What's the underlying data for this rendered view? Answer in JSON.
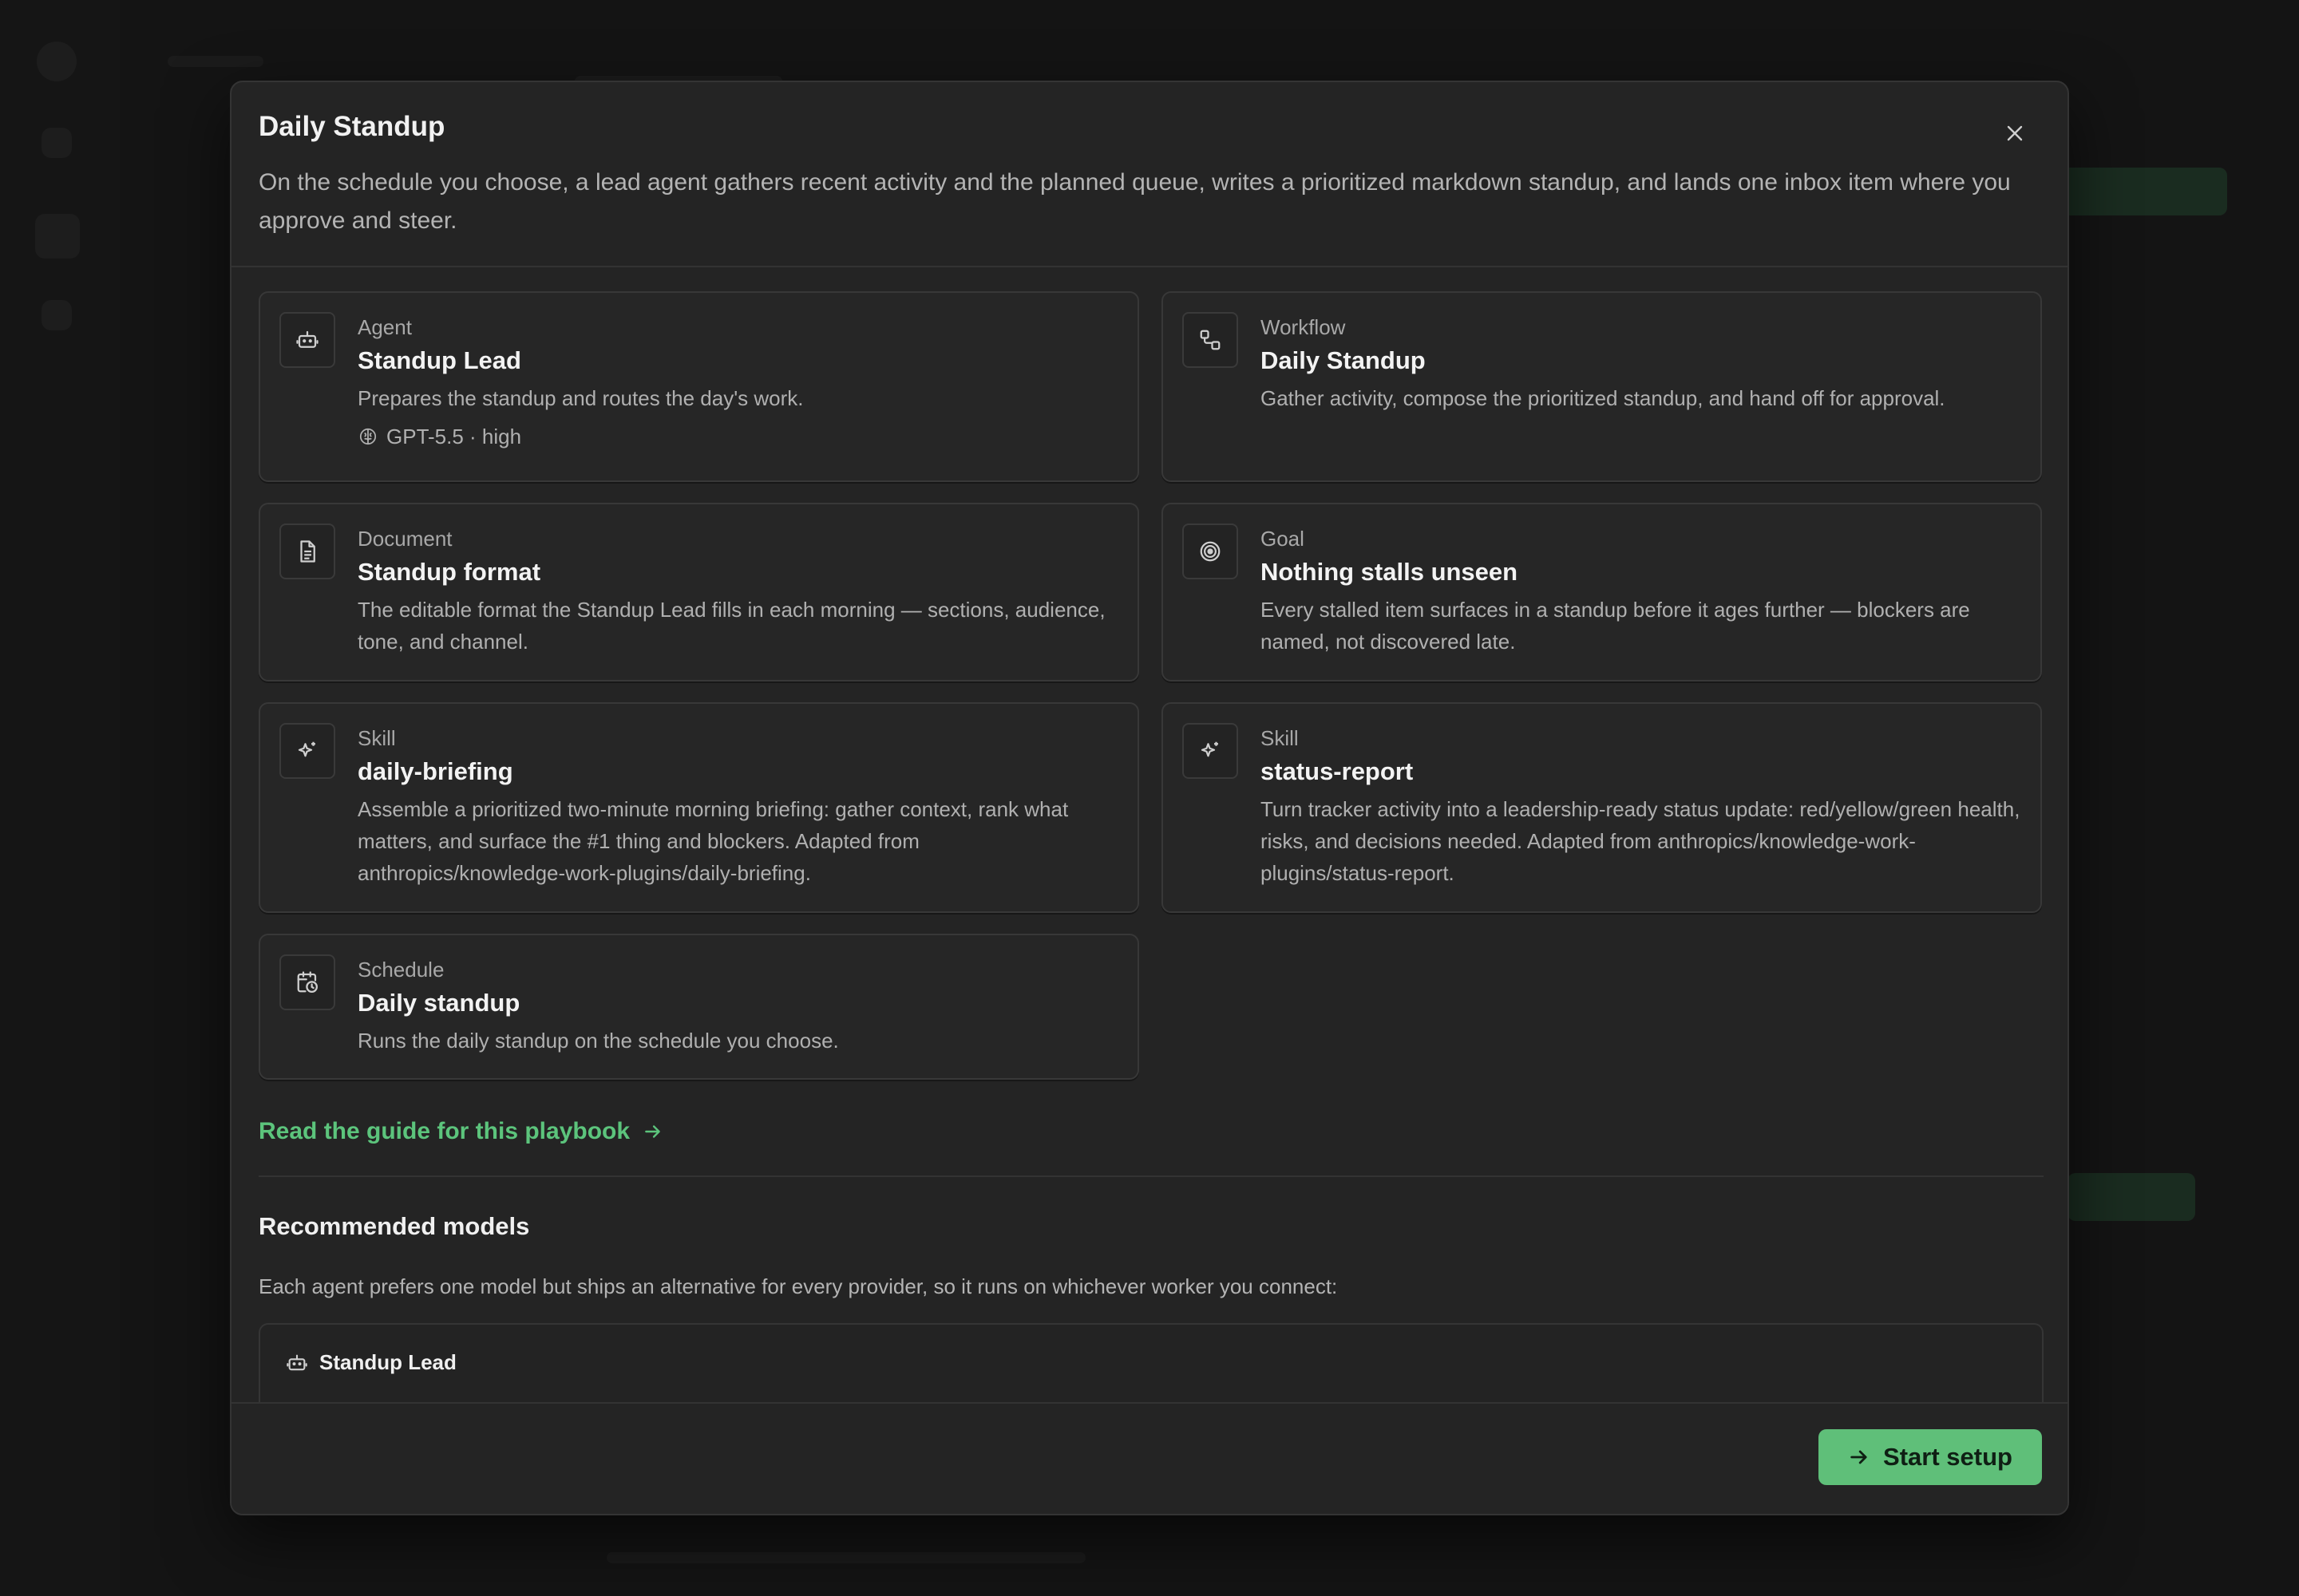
{
  "modal": {
    "title": "Daily Standup",
    "description": "On the schedule you choose, a lead agent gathers recent activity and the planned queue, writes a prioritized markdown standup, and lands one inbox item where you approve and steer."
  },
  "cards": [
    {
      "kind": "Agent",
      "name": "Standup Lead",
      "description": "Prepares the standup and routes the day's work.",
      "meta": "GPT-5.5 · high",
      "icon": "robot-icon"
    },
    {
      "kind": "Workflow",
      "name": "Daily Standup",
      "description": "Gather activity, compose the prioritized standup, and hand off for approval.",
      "icon": "workflow-icon"
    },
    {
      "kind": "Document",
      "name": "Standup format",
      "description": "The editable format the Standup Lead fills in each morning — sections, audience, tone, and channel.",
      "icon": "document-icon"
    },
    {
      "kind": "Goal",
      "name": "Nothing stalls unseen",
      "description": "Every stalled item surfaces in a standup before it ages further — blockers are named, not discovered late.",
      "icon": "target-icon"
    },
    {
      "kind": "Skill",
      "name": "daily-briefing",
      "description": "Assemble a prioritized two-minute morning briefing: gather context, rank what matters, and surface the #1 thing and blockers. Adapted from anthropics/knowledge-work-plugins/daily-briefing.",
      "icon": "sparkle-icon"
    },
    {
      "kind": "Skill",
      "name": "status-report",
      "description": "Turn tracker activity into a leadership-ready status update: red/yellow/green health, risks, and decisions needed. Adapted from anthropics/knowledge-work-plugins/status-report.",
      "icon": "sparkle-icon"
    },
    {
      "kind": "Schedule",
      "name": "Daily standup",
      "description": "Runs the daily standup on the schedule you choose.",
      "icon": "calendar-clock-icon"
    }
  ],
  "guide_link": "Read the guide for this playbook",
  "recommended": {
    "title": "Recommended models",
    "description": "Each agent prefers one model but ships an alternative for every provider, so it runs on whichever worker you connect:",
    "agent_name": "Standup Lead"
  },
  "footer": {
    "start_label": "Start setup"
  },
  "colors": {
    "accent": "#5fbf79",
    "link": "#5cc47c",
    "surface": "#242424"
  }
}
